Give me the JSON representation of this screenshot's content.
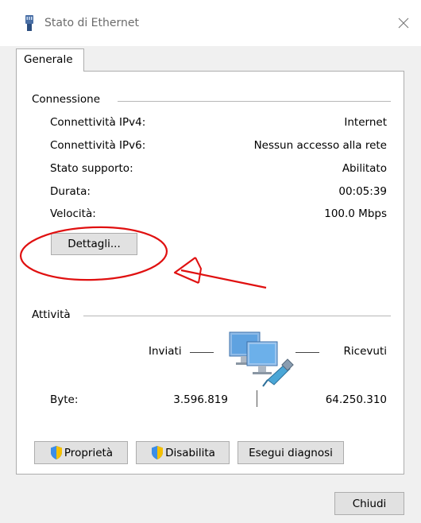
{
  "window": {
    "title": "Stato di Ethernet",
    "close_icon": "close-icon",
    "title_icon": "ethernet-connector-icon"
  },
  "tabs": [
    {
      "label": "Generale",
      "selected": true
    }
  ],
  "connection": {
    "group_title": "Connessione",
    "rows": [
      {
        "label": "Connettività IPv4:",
        "value": "Internet"
      },
      {
        "label": "Connettività IPv6:",
        "value": "Nessun accesso alla rete"
      },
      {
        "label": "Stato supporto:",
        "value": "Abilitato"
      },
      {
        "label": "Durata:",
        "value": "00:05:39"
      },
      {
        "label": "Velocità:",
        "value": "100.0 Mbps"
      }
    ],
    "details_button": "Dettagli..."
  },
  "activity": {
    "group_title": "Attività",
    "sent_label": "Inviati",
    "received_label": "Ricevuti",
    "bytes_label": "Byte:",
    "bytes_sent": "3.596.819",
    "bytes_received": "64.250.310",
    "network_icon": "network-computers-icon"
  },
  "buttons": {
    "properties": "Proprietà",
    "disable": "Disabilita",
    "diagnose": "Esegui diagnosi",
    "close": "Chiudi"
  },
  "colors": {
    "annotation_red": "#e01010",
    "button_bg": "#e1e1e1",
    "border": "#adadad"
  }
}
